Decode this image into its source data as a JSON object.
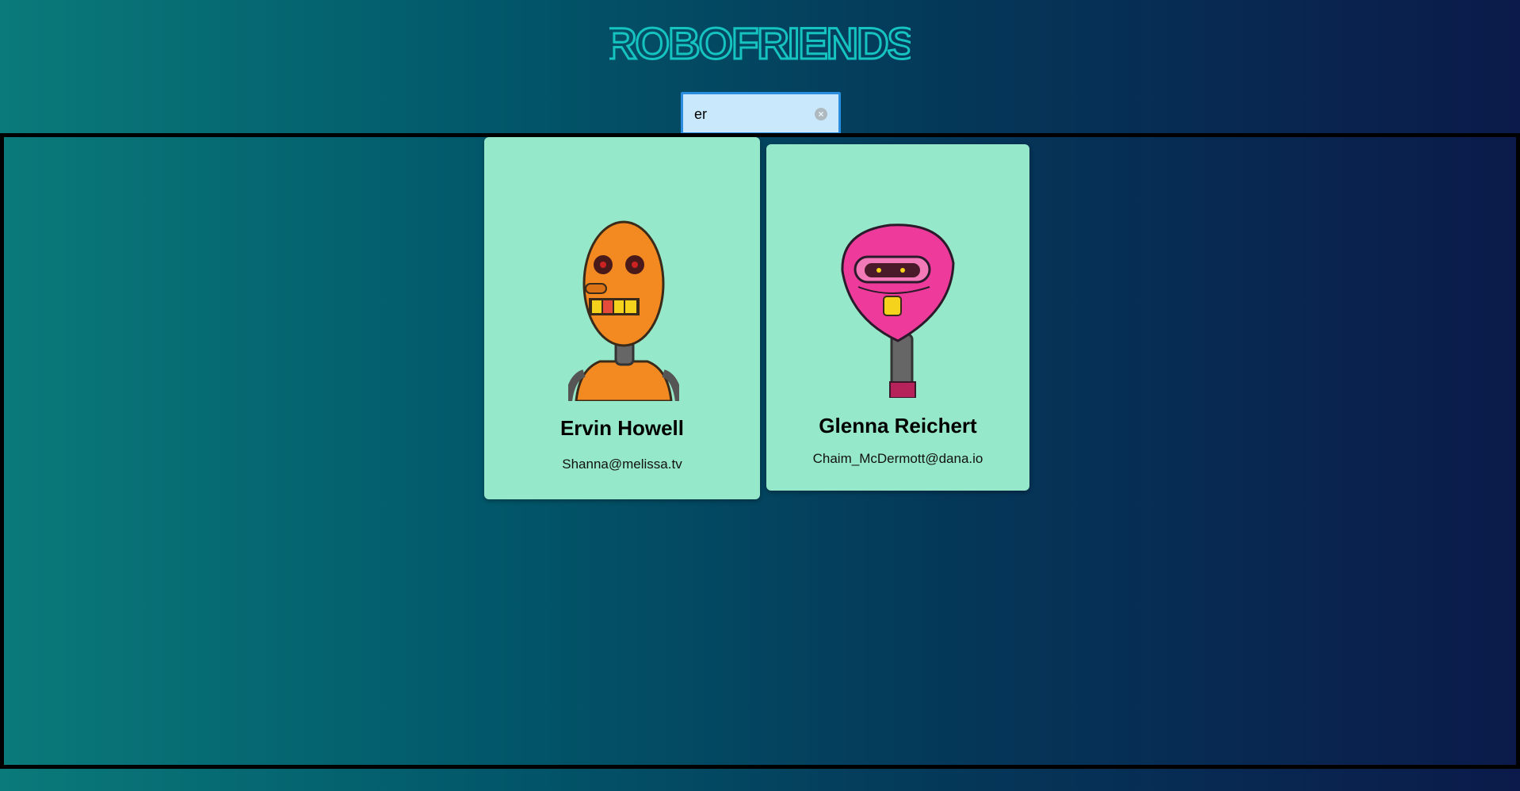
{
  "app": {
    "title": "ROBOFRIENDS"
  },
  "search": {
    "value": "er",
    "clear_icon": "clear-x-icon"
  },
  "robots": [
    {
      "name": "Ervin Howell",
      "email": "Shanna@melissa.tv",
      "avatar_color": "#f28a21"
    },
    {
      "name": "Glenna Reichert",
      "email": "Chaim_McDermott@dana.io",
      "avatar_color": "#ee3a9a"
    }
  ],
  "colors": {
    "title": "#15c3c0",
    "card": "#96e8ca",
    "search_bg": "#c9e8fb",
    "search_border": "#2a8de0"
  }
}
